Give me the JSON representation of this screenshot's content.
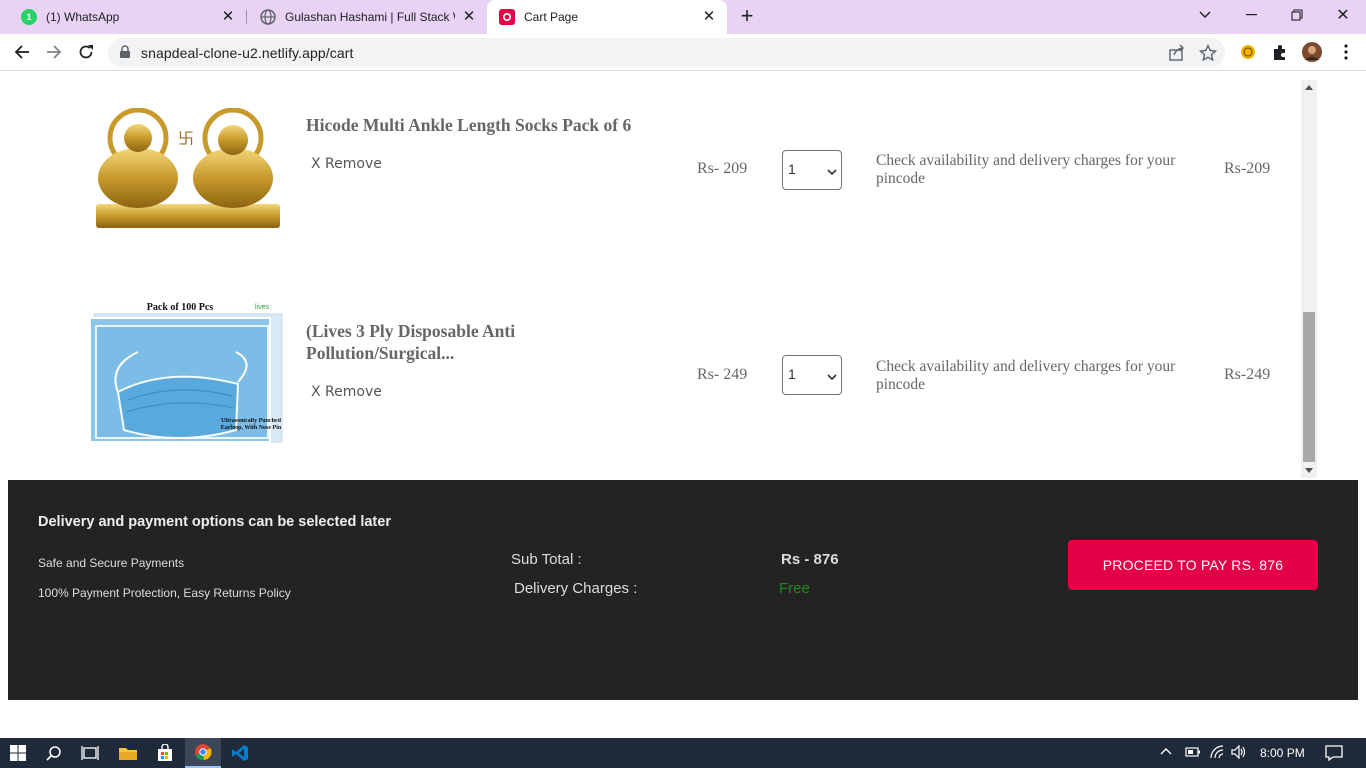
{
  "browser": {
    "tabs": [
      {
        "title": "(1) WhatsApp",
        "badge": "1",
        "favicon": "whatsapp-icon"
      },
      {
        "title": "Gulashan Hashami | Full Stack We",
        "favicon": "globe-icon"
      },
      {
        "title": "Cart Page",
        "favicon": "snapdeal-icon",
        "active": true
      }
    ],
    "url": "snapdeal-clone-u2.netlify.app/cart"
  },
  "cart": {
    "items": [
      {
        "name": "Hicode Multi Ankle Length Socks Pack of 6",
        "remove_label": "X Remove",
        "price": "Rs- 209",
        "quantity": "1",
        "availability": "Check availability and delivery charges for your pincode",
        "total": "Rs-209",
        "image": "golden-idols-image"
      },
      {
        "name": "(Lives 3 Ply Disposable Anti Pollution/Surgical...",
        "remove_label": "X Remove",
        "price": "Rs- 249",
        "quantity": "1",
        "availability": "Check availability and delivery charges for your pincode",
        "total": "Rs-249",
        "image": "face-mask-pack-image",
        "image_text": {
          "top": "Pack of 100 Pcs",
          "brand": "lives",
          "bottom": "Ultrasonically Punched Earloop, With Nose Pin"
        }
      }
    ]
  },
  "footer": {
    "heading": "Delivery and payment options can be selected later",
    "lines": [
      "Safe and Secure Payments",
      "100% Payment Protection, Easy Returns Policy"
    ],
    "subtotal_label": "Sub Total :",
    "subtotal_value": "Rs - 876",
    "delivery_label": "Delivery Charges :",
    "delivery_value": "Free",
    "pay_button": "PROCEED TO PAY RS. 876",
    "colors": {
      "background": "#232323",
      "button": "#e40046",
      "free": "#1f8a1f"
    }
  },
  "taskbar": {
    "time": "8:00 PM"
  }
}
